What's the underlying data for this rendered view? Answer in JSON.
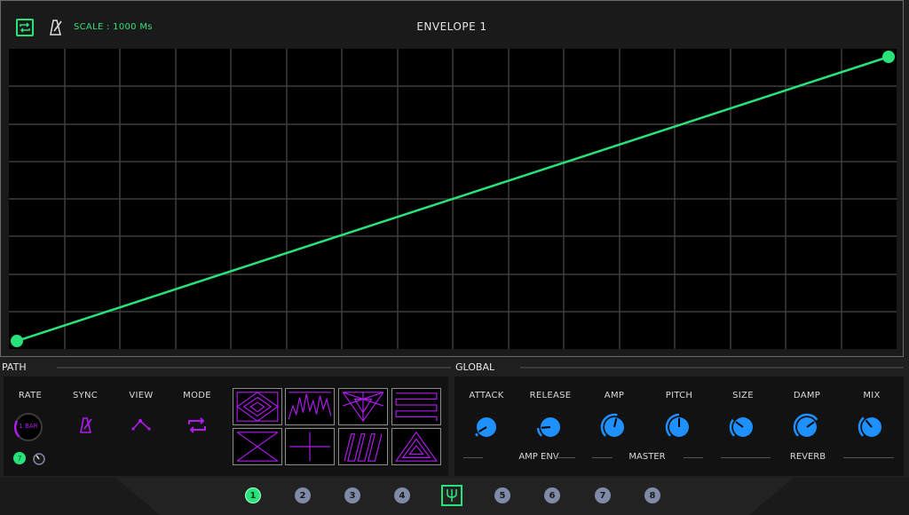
{
  "header": {
    "scale_label": "SCALE : 1000 Ms",
    "title": "ENVELOPE 1"
  },
  "envelope": {
    "start_point": {
      "x": 0.0,
      "y": 0.0
    },
    "end_point": {
      "x": 1.0,
      "y": 1.0
    }
  },
  "sections": {
    "path": "PATH",
    "global": "GLOBAL"
  },
  "path": {
    "rate_label": "RATE",
    "rate_value": "1 BAR",
    "rate_badge": "7",
    "sync_label": "SYNC",
    "view_label": "VIEW",
    "mode_label": "MODE"
  },
  "global": {
    "knobs": [
      {
        "label": "ATTACK",
        "value": 0.05
      },
      {
        "label": "RELEASE",
        "value": 0.15
      },
      {
        "label": "AMP",
        "value": 0.55
      },
      {
        "label": "PITCH",
        "value": 0.5
      },
      {
        "label": "SIZE",
        "value": 0.3
      },
      {
        "label": "DAMP",
        "value": 0.7
      },
      {
        "label": "MIX",
        "value": 0.35
      }
    ],
    "groups": [
      "AMP ENV",
      "MASTER",
      "REVERB"
    ]
  },
  "nav": {
    "items": [
      "1",
      "2",
      "3",
      "4",
      "5",
      "6",
      "7",
      "8"
    ],
    "active": "1"
  },
  "colors": {
    "accent_green": "#27e37a",
    "accent_purple": "#b21bf0",
    "knob_blue": "#1e90ff"
  }
}
